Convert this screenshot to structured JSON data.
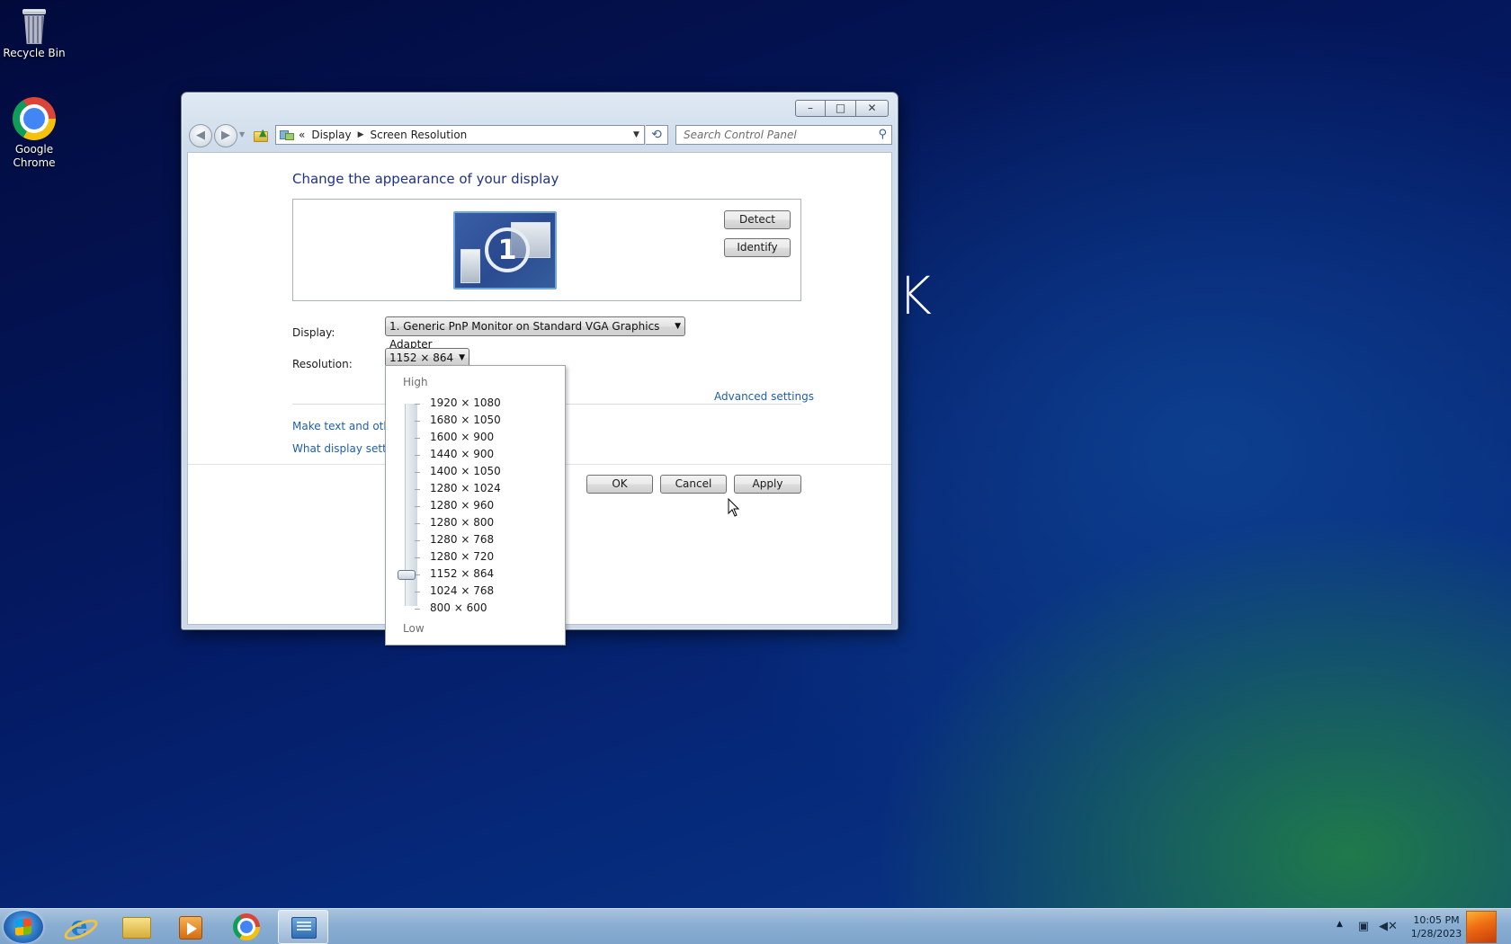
{
  "desktop": {
    "icons": [
      {
        "label": "Recycle Bin",
        "icon": "recycle-bin-icon"
      },
      {
        "label": "Google Chrome",
        "icon": "chrome-icon"
      }
    ],
    "stray_text": "K"
  },
  "window": {
    "controls": {
      "minimize": "–",
      "maximize": "□",
      "close": "✕"
    },
    "nav": {
      "back": "◀",
      "forward": "▶"
    },
    "breadcrumb": {
      "prefix": "«",
      "items": [
        "Display",
        "Screen Resolution"
      ]
    },
    "search": {
      "placeholder": "Search Control Panel"
    },
    "heading": "Change the appearance of your display",
    "monitor_number": "1",
    "buttons": {
      "detect": "Detect",
      "identify": "Identify",
      "ok": "OK",
      "cancel": "Cancel",
      "apply": "Apply"
    },
    "display": {
      "label": "Display:",
      "value": "1. Generic PnP Monitor on Standard VGA Graphics Adapter"
    },
    "resolution": {
      "label": "Resolution:",
      "value": "1152 × 864"
    },
    "links": {
      "advanced": "Advanced settings",
      "make_text": "Make text and other",
      "what_display": "What display setting"
    }
  },
  "resolution_dropdown": {
    "high_label": "High",
    "low_label": "Low",
    "options": [
      "1920 × 1080",
      "1680 × 1050",
      "1600 × 900",
      "1440 × 900",
      "1400 × 1050",
      "1280 × 1024",
      "1280 × 960",
      "1280 × 800",
      "1280 × 768",
      "1280 × 720",
      "1152 × 864",
      "1024 × 768",
      "800 × 600"
    ],
    "selected": "1152 × 864"
  },
  "taskbar": {
    "apps": [
      {
        "name": "Internet Explorer",
        "icon": "ie-icon"
      },
      {
        "name": "Windows Explorer",
        "icon": "folder-icon"
      },
      {
        "name": "Windows Media Player",
        "icon": "media-player-icon"
      },
      {
        "name": "Google Chrome",
        "icon": "chrome-icon"
      },
      {
        "name": "Control Panel",
        "icon": "control-panel-icon",
        "active": true
      }
    ],
    "clock": {
      "time": "10:05 PM",
      "date": "1/28/2023"
    }
  }
}
